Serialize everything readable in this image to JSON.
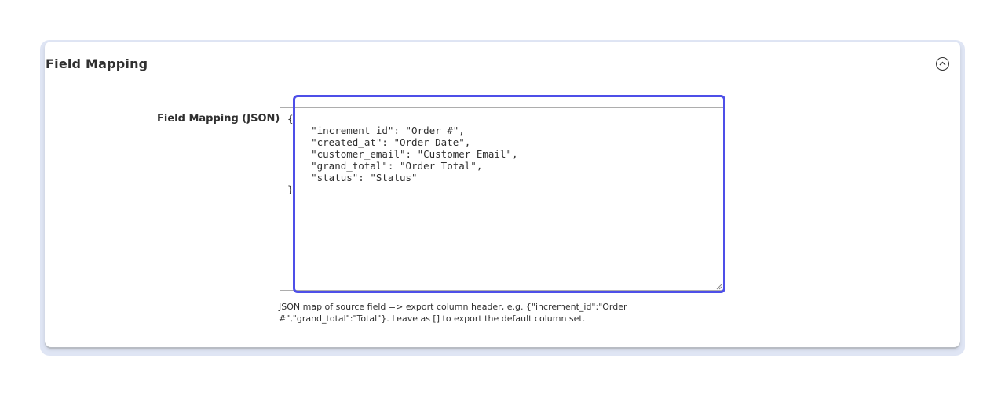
{
  "section": {
    "title": "Field Mapping",
    "collapse_icon": "chevron-up-circle-icon"
  },
  "field": {
    "label": "Field Mapping (JSON)",
    "value": "{\n    \"increment_id\": \"Order #\",\n    \"created_at\": \"Order Date\",\n    \"customer_email\": \"Customer Email\",\n    \"grand_total\": \"Order Total\",\n    \"status\": \"Status\"\n}",
    "note": "JSON map of source field => export column header, e.g. {\"increment_id\":\"Order #\",\"grand_total\":\"Total\"}. Leave as [] to export the default column set."
  },
  "colors": {
    "focus_ring": "#4e4fe8",
    "section_halo": "#dfe5f4"
  }
}
